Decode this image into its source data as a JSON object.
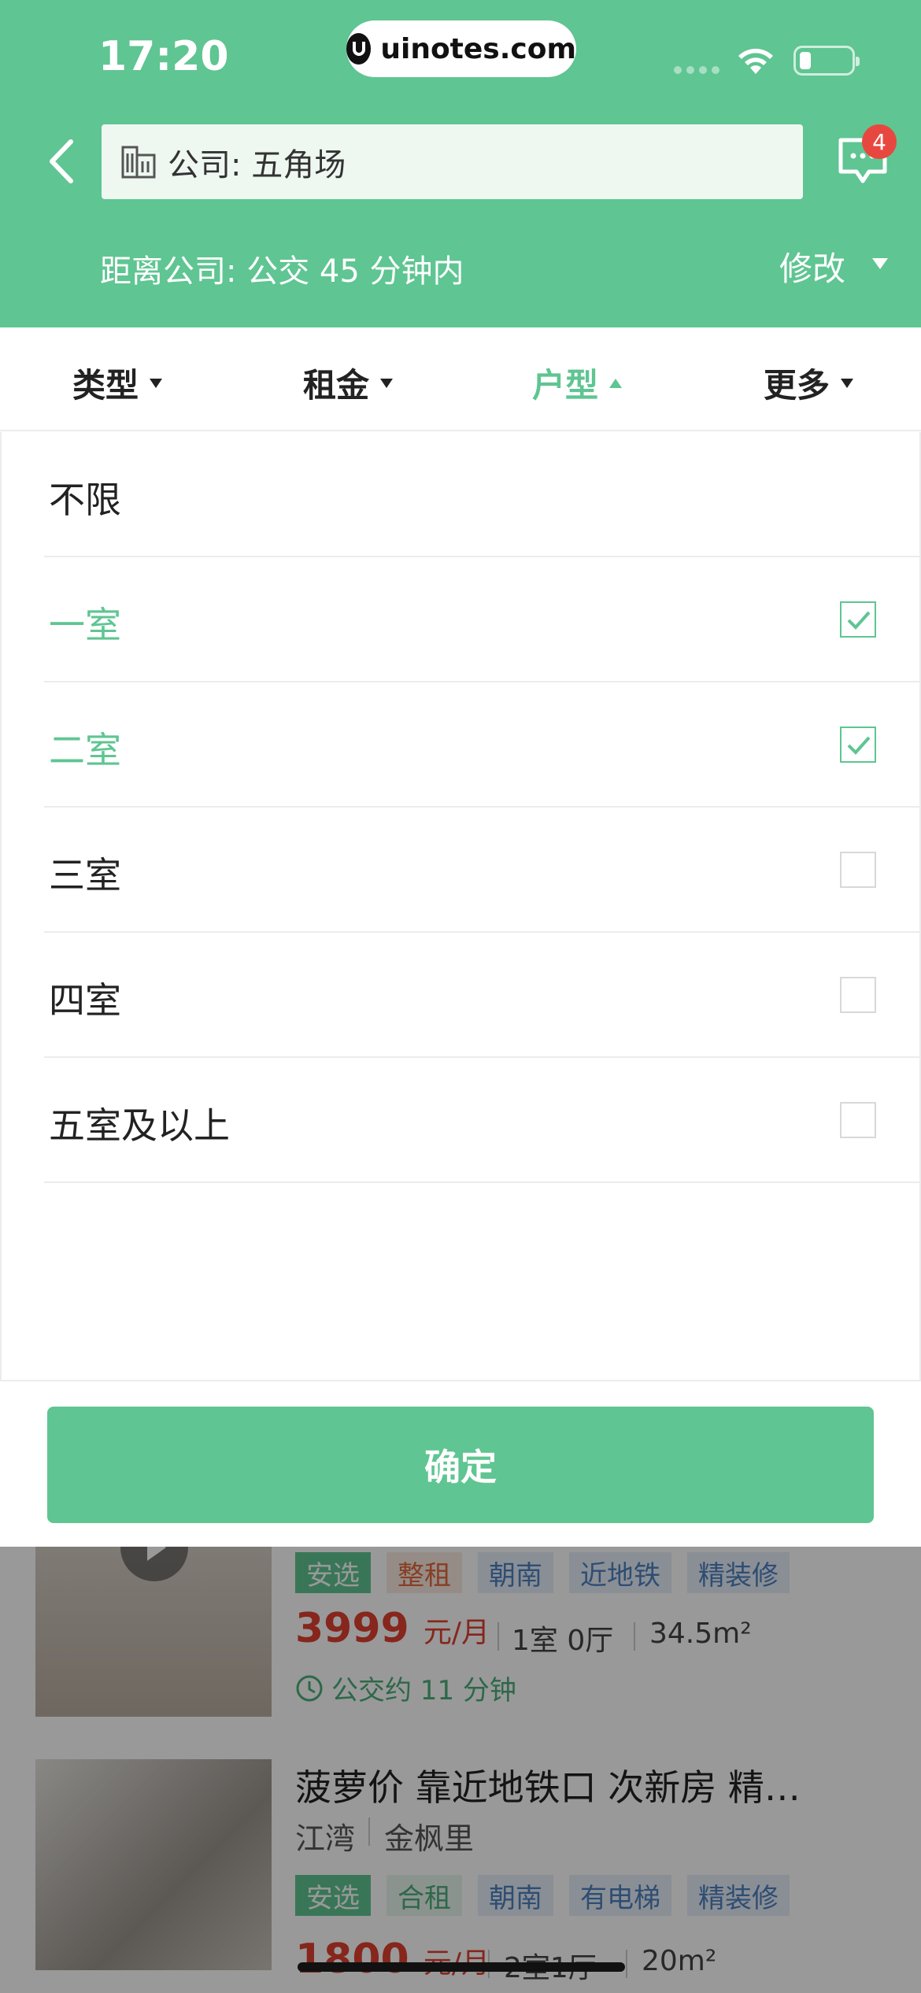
{
  "status_bar": {
    "time": "17:20",
    "url": "uinotes.com"
  },
  "header": {
    "search_text": "公司: 五角场",
    "badge_count": "4",
    "distance_text": "距离公司: 公交 45 分钟内",
    "modify_label": "修改"
  },
  "filters": {
    "tabs": [
      {
        "label": "类型",
        "active": false
      },
      {
        "label": "租金",
        "active": false
      },
      {
        "label": "户型",
        "active": true
      },
      {
        "label": "更多",
        "active": false
      }
    ]
  },
  "options": [
    {
      "label": "不限",
      "checked": false,
      "has_checkbox": false
    },
    {
      "label": "一室",
      "checked": true,
      "has_checkbox": true
    },
    {
      "label": "二室",
      "checked": true,
      "has_checkbox": true
    },
    {
      "label": "三室",
      "checked": false,
      "has_checkbox": true
    },
    {
      "label": "四室",
      "checked": false,
      "has_checkbox": true
    },
    {
      "label": "五室及以上",
      "checked": false,
      "has_checkbox": true
    }
  ],
  "confirm_label": "确定",
  "listings": [
    {
      "tags": [
        "安选",
        "整租",
        "朝南",
        "近地铁",
        "精装修"
      ],
      "price": "3999",
      "price_unit": "元/月",
      "layout": "1室 0厅",
      "area": "34.5m²",
      "commute": "公交约 11 分钟"
    },
    {
      "title": "菠萝价  靠近地铁口  次新房  精…",
      "district": "江湾",
      "community": "金枫里",
      "tags": [
        "安选",
        "合租",
        "朝南",
        "有电梯",
        "精装修"
      ],
      "price": "1800",
      "price_unit": "元/月",
      "layout": "2室1厅",
      "area": "20m²"
    }
  ],
  "colors": {
    "brand_green": "#5fc592",
    "price_red": "#e0402f",
    "badge_red": "#e8473f"
  }
}
